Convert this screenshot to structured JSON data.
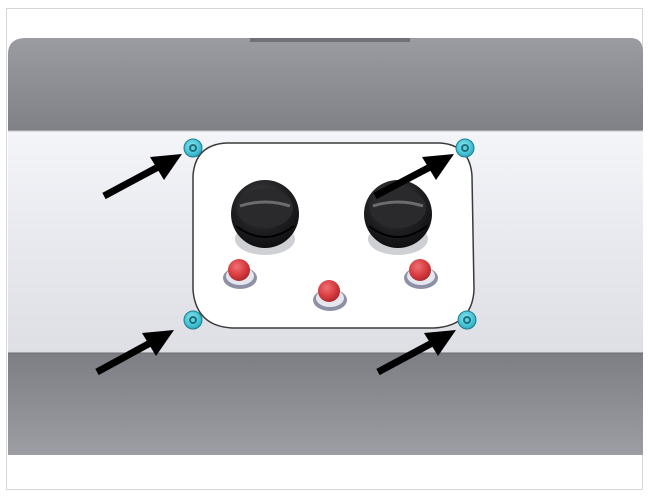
{
  "figure": {
    "description_free": true,
    "colors": {
      "housing_top": "#8c8e94",
      "housing_band": "#ecedf2",
      "housing_bottom": "#84868c",
      "panel": "#ffffff",
      "screw": "#46c6d8",
      "button": "#d83a3e",
      "knob": "#1b1b1d",
      "arrow": "#000000"
    },
    "components": {
      "screws": [
        {
          "name": "screw-top-left-icon"
        },
        {
          "name": "screw-top-right-icon"
        },
        {
          "name": "screw-bottom-left-icon"
        },
        {
          "name": "screw-bottom-right-icon"
        }
      ],
      "knobs": [
        {
          "name": "knob-left-icon"
        },
        {
          "name": "knob-right-icon"
        }
      ],
      "buttons": [
        {
          "name": "button-left-icon"
        },
        {
          "name": "button-center-icon"
        },
        {
          "name": "button-right-icon"
        }
      ],
      "arrows": [
        {
          "name": "arrow-top-left-icon",
          "points_to": "screw-top-left-icon"
        },
        {
          "name": "arrow-top-right-icon",
          "points_to": "screw-top-right-icon"
        },
        {
          "name": "arrow-bottom-left-icon",
          "points_to": "screw-bottom-left-icon"
        },
        {
          "name": "arrow-bottom-right-icon",
          "points_to": "screw-bottom-right-icon"
        }
      ]
    }
  }
}
